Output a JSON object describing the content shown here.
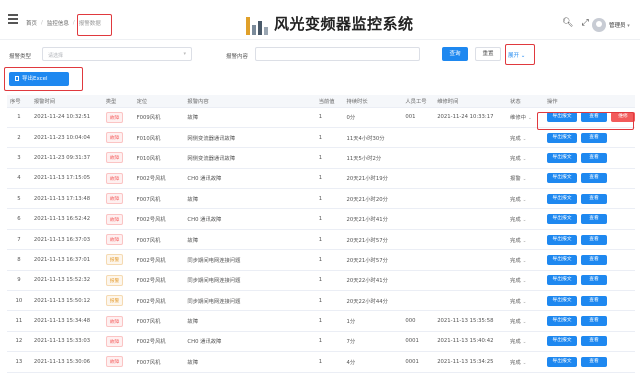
{
  "header": {
    "breadcrumbs": [
      "首页",
      "监控信息",
      "报警数据"
    ],
    "title": "风光变频器监控系统",
    "user": "管理员"
  },
  "filters": {
    "type_label": "报警类型",
    "type_placeholder": "请选择",
    "content_label": "报警内容",
    "search_label": "查询",
    "reset_label": "重置",
    "expand_label": "展开"
  },
  "export_label": "导出Excel",
  "table": {
    "columns": [
      "序号",
      "报警时间",
      "类型",
      "定位",
      "报警内容",
      "当前值",
      "持续时长",
      "人员工号",
      "维修时间",
      "状态",
      "操作"
    ],
    "rows": [
      {
        "no": "1",
        "time": "2021-11-24 10:32:51",
        "type": "故障",
        "loc": "F009风机",
        "content": "故障",
        "value": "1",
        "duration": "0分",
        "staff": "001",
        "repair": "2021-11-24 10:33:17",
        "state": "维修中",
        "tag": "red"
      },
      {
        "no": "2",
        "time": "2021-11-23 10:04:04",
        "type": "故障",
        "loc": "F010风机",
        "content": "网侧变流器通讯故障",
        "value": "1",
        "duration": "11天4小时30分",
        "staff": "",
        "repair": "",
        "state": "完成",
        "tag": "red"
      },
      {
        "no": "3",
        "time": "2021-11-23 09:31:37",
        "type": "故障",
        "loc": "F010风机",
        "content": "网侧变流器通讯故障",
        "value": "1",
        "duration": "11天5小时2分",
        "staff": "",
        "repair": "",
        "state": "完成",
        "tag": "red"
      },
      {
        "no": "4",
        "time": "2021-11-13 17:15:05",
        "type": "故障",
        "loc": "F002号风机",
        "content": "CH0 通讯故障",
        "value": "1",
        "duration": "20天21小时19分",
        "staff": "",
        "repair": "",
        "state": "报警",
        "tag": "red"
      },
      {
        "no": "5",
        "time": "2021-11-13 17:13:48",
        "type": "故障",
        "loc": "F007风机",
        "content": "故障",
        "value": "1",
        "duration": "20天21小时20分",
        "staff": "",
        "repair": "",
        "state": "完成",
        "tag": "red"
      },
      {
        "no": "6",
        "time": "2021-11-13 16:52:42",
        "type": "故障",
        "loc": "F002号风机",
        "content": "CH0 通讯故障",
        "value": "1",
        "duration": "20天21小时41分",
        "staff": "",
        "repair": "",
        "state": "完成",
        "tag": "red"
      },
      {
        "no": "7",
        "time": "2021-11-13 16:37:03",
        "type": "故障",
        "loc": "F007风机",
        "content": "故障",
        "value": "1",
        "duration": "20天21小时57分",
        "staff": "",
        "repair": "",
        "state": "完成",
        "tag": "red"
      },
      {
        "no": "8",
        "time": "2021-11-13 16:37:01",
        "type": "报警",
        "loc": "F002号风机",
        "content": "同步期间电网连接问题",
        "value": "1",
        "duration": "20天21小时57分",
        "staff": "",
        "repair": "",
        "state": "完成",
        "tag": "orange"
      },
      {
        "no": "9",
        "time": "2021-11-13 15:52:32",
        "type": "报警",
        "loc": "F002号风机",
        "content": "同步期间电网连接问题",
        "value": "1",
        "duration": "20天22小时41分",
        "staff": "",
        "repair": "",
        "state": "完成",
        "tag": "orange"
      },
      {
        "no": "10",
        "time": "2021-11-13 15:50:12",
        "type": "报警",
        "loc": "F002号风机",
        "content": "同步期间电网连接问题",
        "value": "1",
        "duration": "20天22小时44分",
        "staff": "",
        "repair": "",
        "state": "完成",
        "tag": "orange"
      },
      {
        "no": "11",
        "time": "2021-11-13 15:34:48",
        "type": "故障",
        "loc": "F007风机",
        "content": "故障",
        "value": "1",
        "duration": "1分",
        "staff": "000",
        "repair": "2021-11-13 15:35:58",
        "state": "完成",
        "tag": "red"
      },
      {
        "no": "12",
        "time": "2021-11-13 15:33:03",
        "type": "故障",
        "loc": "F002号风机",
        "content": "CH0 通讯故障",
        "value": "1",
        "duration": "7分",
        "staff": "0001",
        "repair": "2021-11-13 15:40:42",
        "state": "完成",
        "tag": "red"
      },
      {
        "no": "13",
        "time": "2021-11-13 15:30:06",
        "type": "故障",
        "loc": "F007风机",
        "content": "故障",
        "value": "1",
        "duration": "4分",
        "staff": "0001",
        "repair": "2021-11-13 15:34:25",
        "state": "完成",
        "tag": "red"
      }
    ],
    "op_export": "导出报文",
    "op_view": "查看",
    "op_repair": "维修"
  }
}
